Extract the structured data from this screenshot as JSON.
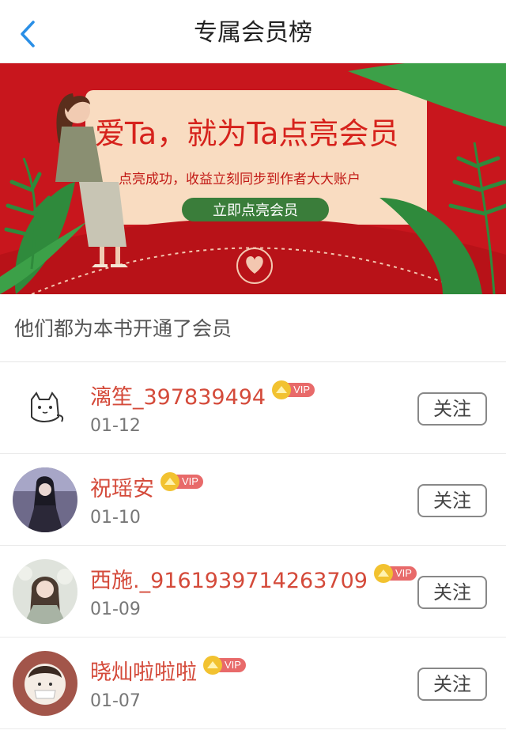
{
  "header": {
    "title": "专属会员榜"
  },
  "banner": {
    "headline": "爱Ta，就为Ta点亮会员",
    "subtitle": "点亮成功，收益立刻同步到作者大大账户",
    "cta": "立即点亮会员"
  },
  "section": {
    "title": "他们都为本书开通了会员"
  },
  "members": [
    {
      "name": "漓笙_397839494",
      "badge": "VIP",
      "date": "01-12",
      "follow": "关注"
    },
    {
      "name": "祝瑶安",
      "badge": "VIP",
      "date": "01-10",
      "follow": "关注"
    },
    {
      "name": "西施._9161939714263709",
      "badge": "VIP",
      "date": "01-09",
      "follow": "关注"
    },
    {
      "name": "晓灿啦啦啦",
      "badge": "VIP",
      "date": "01-07",
      "follow": "关注"
    }
  ],
  "colors": {
    "accent_name": "#d44a3a",
    "back_arrow": "#2a8fe6",
    "banner_red": "#c8161d",
    "cta_green": "#3a7d3a"
  }
}
